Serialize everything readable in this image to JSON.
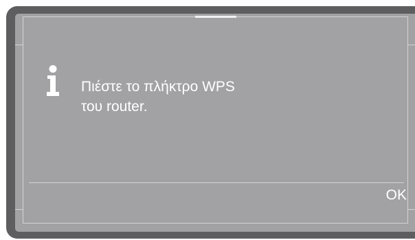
{
  "dialog": {
    "icon": "info-icon",
    "message_lines": [
      "Πιέστε το πλήκτρο WPS",
      "του router."
    ],
    "ok_label": "OK"
  },
  "colors": {
    "bezel": "#5e5e60",
    "screen": "#a2a2a4",
    "text": "#ffffff",
    "lines": "#d4d4d6"
  }
}
